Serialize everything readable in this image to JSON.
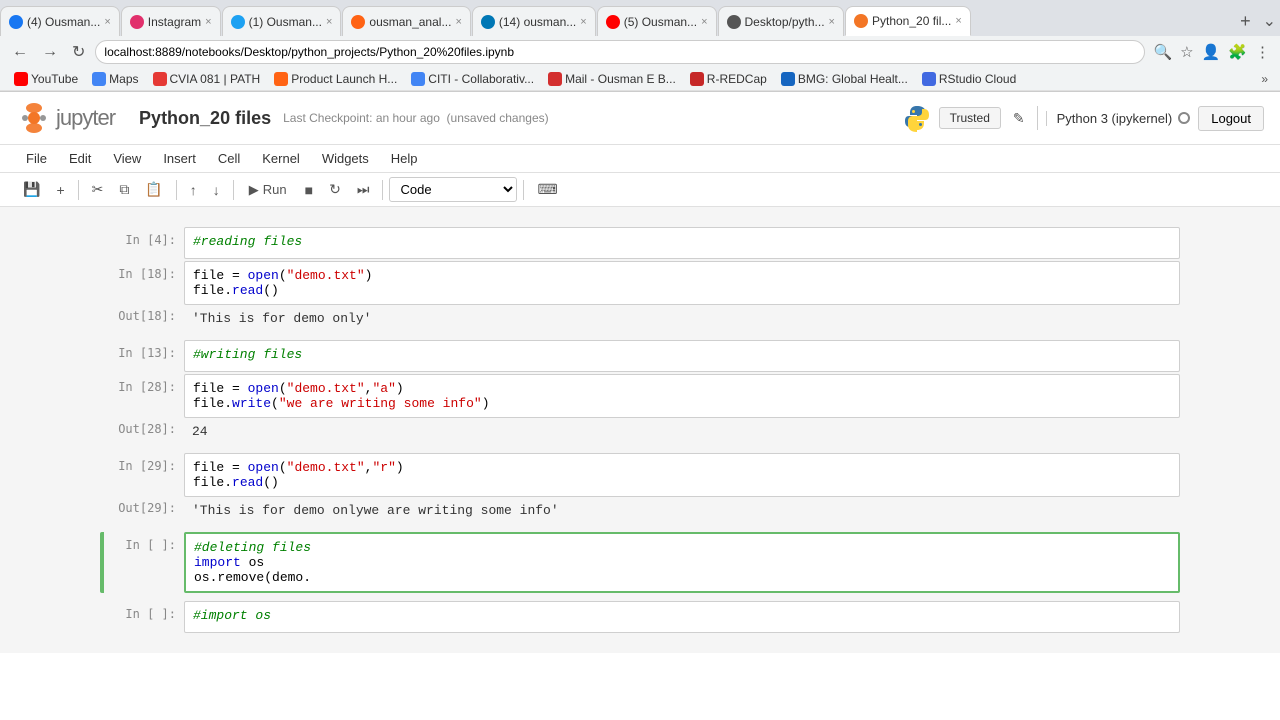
{
  "browser": {
    "tabs": [
      {
        "id": "tab1",
        "favicon_color": "#1877f2",
        "label": "(4) Ousman...",
        "active": false
      },
      {
        "id": "tab2",
        "favicon_color": "#e1306c",
        "label": "Instagram",
        "active": false
      },
      {
        "id": "tab3",
        "favicon_color": "#1da1f2",
        "label": "(1) Ousman...",
        "active": false
      },
      {
        "id": "tab4",
        "favicon_color": "#ff6314",
        "label": "ousman_anal...",
        "active": false
      },
      {
        "id": "tab5",
        "favicon_color": "#0077b5",
        "label": "(14) ousman...",
        "active": false
      },
      {
        "id": "tab6",
        "favicon_color": "#ff0000",
        "label": "(5) Ousman...",
        "active": false
      },
      {
        "id": "tab7",
        "favicon_color": "#555",
        "label": "Desktop/pyth...",
        "active": false
      },
      {
        "id": "tab8",
        "favicon_color": "#f37626",
        "label": "Python_20 fil...",
        "active": true
      }
    ],
    "address": "localhost:8889/notebooks/Desktop/python_projects/Python_20%20files.ipynb",
    "bookmarks": [
      {
        "label": "YouTube",
        "color": "#ff0000"
      },
      {
        "label": "Maps",
        "color": "#4285f4"
      },
      {
        "label": "CVIA 081 | PATH",
        "color": "#e53935"
      },
      {
        "label": "Product Launch H...",
        "color": "#ff6314"
      },
      {
        "label": "CITI - Collaborativ...",
        "color": "#4285f4"
      },
      {
        "label": "Mail - Ousman E B...",
        "color": "#d32f2f"
      },
      {
        "label": "R-REDCap",
        "color": "#c62828"
      },
      {
        "label": "BMG: Global Healt...",
        "color": "#1565c0"
      },
      {
        "label": "RStudio Cloud",
        "color": "#4169e1"
      }
    ]
  },
  "jupyter": {
    "logo_text": "jupyter",
    "filename": "Python_20 files",
    "checkpoint": "Last Checkpoint: an hour ago",
    "unsaved": "(unsaved changes)",
    "trusted_label": "Trusted",
    "edit_icon": "✎",
    "kernel_name": "Python 3 (ipykernel)",
    "logout_label": "Logout"
  },
  "menu": {
    "items": [
      "File",
      "Edit",
      "View",
      "Insert",
      "Cell",
      "Kernel",
      "Widgets",
      "Help"
    ]
  },
  "toolbar": {
    "save_icon": "💾",
    "add_icon": "+",
    "cut_icon": "✂",
    "copy_icon": "⧉",
    "paste_icon": "📋",
    "up_icon": "↑",
    "down_icon": "↓",
    "run_label": "Run",
    "stop_icon": "■",
    "restart_icon": "↻",
    "fast_forward_icon": "⏭",
    "cell_type": "Code",
    "keyboard_icon": "⌨"
  },
  "cells": [
    {
      "id": "cell-reading-comment",
      "in_label": "In [4]:",
      "code": "#reading files",
      "type": "comment",
      "active": false
    },
    {
      "id": "cell-file-open",
      "in_label": "In [18]:",
      "code_lines": [
        {
          "type": "mixed",
          "parts": [
            {
              "text": "file = ",
              "class": "normal"
            },
            {
              "text": "open",
              "class": "kw-blue"
            },
            {
              "text": "(",
              "class": "normal"
            },
            {
              "text": "\"demo.txt\"",
              "class": "str-red"
            },
            {
              "text": ")",
              "class": "normal"
            }
          ]
        },
        {
          "type": "mixed",
          "parts": [
            {
              "text": "file.",
              "class": "normal"
            },
            {
              "text": "read",
              "class": "kw-blue"
            },
            {
              "text": "()",
              "class": "normal"
            }
          ]
        }
      ],
      "active": false
    },
    {
      "id": "out-18",
      "out_label": "Out[18]:",
      "output": "'This is for demo only'"
    },
    {
      "id": "cell-writing-comment",
      "in_label": "In [13]:",
      "code": "#writing files",
      "type": "comment",
      "active": false
    },
    {
      "id": "cell-file-write",
      "in_label": "In [28]:",
      "code_lines": [
        {
          "type": "mixed",
          "parts": [
            {
              "text": "file = ",
              "class": "normal"
            },
            {
              "text": "open",
              "class": "kw-blue"
            },
            {
              "text": "(",
              "class": "normal"
            },
            {
              "text": "\"demo.txt\"",
              "class": "str-red"
            },
            {
              "text": ",",
              "class": "normal"
            },
            {
              "text": "\"a\"",
              "class": "str-red"
            },
            {
              "text": ")",
              "class": "normal"
            }
          ]
        },
        {
          "type": "mixed",
          "parts": [
            {
              "text": "file.",
              "class": "normal"
            },
            {
              "text": "write",
              "class": "kw-blue"
            },
            {
              "text": "(",
              "class": "normal"
            },
            {
              "text": "\"we are writing some info\"",
              "class": "str-red"
            },
            {
              "text": ")",
              "class": "normal"
            }
          ]
        }
      ],
      "active": false
    },
    {
      "id": "out-28",
      "out_label": "Out[28]:",
      "output": "24"
    },
    {
      "id": "cell-file-read2",
      "in_label": "In [29]:",
      "code_lines": [
        {
          "type": "mixed",
          "parts": [
            {
              "text": "file = ",
              "class": "normal"
            },
            {
              "text": "open",
              "class": "kw-blue"
            },
            {
              "text": "(",
              "class": "normal"
            },
            {
              "text": "\"demo.txt\"",
              "class": "str-red"
            },
            {
              "text": ",",
              "class": "normal"
            },
            {
              "text": "\"r\"",
              "class": "str-red"
            },
            {
              "text": ")",
              "class": "normal"
            }
          ]
        },
        {
          "type": "mixed",
          "parts": [
            {
              "text": "file.",
              "class": "normal"
            },
            {
              "text": "read",
              "class": "kw-blue"
            },
            {
              "text": "()",
              "class": "normal"
            }
          ]
        }
      ],
      "active": false
    },
    {
      "id": "out-29",
      "out_label": "Out[29]:",
      "output": "'This is for demo onlywe are writing some info'"
    },
    {
      "id": "cell-deleting",
      "in_label": "In [ ]:",
      "code_lines": [
        {
          "type": "comment",
          "text": "#deleting files"
        },
        {
          "type": "mixed",
          "parts": [
            {
              "text": "import",
              "class": "kw-blue"
            },
            {
              "text": " os",
              "class": "normal"
            }
          ]
        },
        {
          "type": "mixed",
          "parts": [
            {
              "text": "os.remove(demo.",
              "class": "normal"
            }
          ]
        }
      ],
      "active": true
    },
    {
      "id": "cell-import-os",
      "in_label": "In [ ]:",
      "code": "#import os",
      "type": "comment",
      "active": false
    }
  ]
}
